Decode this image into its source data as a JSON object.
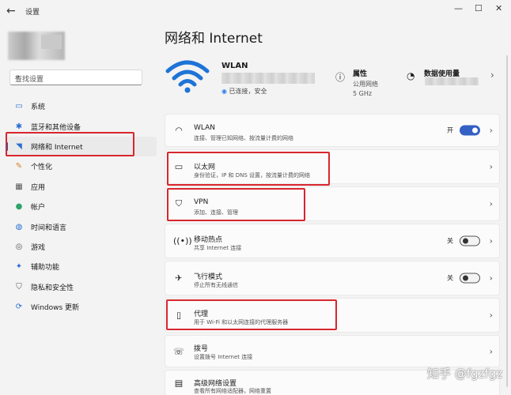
{
  "window": {
    "app_title": "设置",
    "back_icon": "arrow-left-icon",
    "controls": [
      "—",
      "☐",
      "✕"
    ]
  },
  "search": {
    "placeholder": "查找设置"
  },
  "sidebar": {
    "items": [
      {
        "label": "系统",
        "icon": "monitor-icon"
      },
      {
        "label": "蓝牙和其他设备",
        "icon": "bluetooth-icon"
      },
      {
        "label": "网络和 Internet",
        "icon": "wifi-icon",
        "active": true
      },
      {
        "label": "个性化",
        "icon": "brush-icon"
      },
      {
        "label": "应用",
        "icon": "apps-icon"
      },
      {
        "label": "帐户",
        "icon": "person-icon"
      },
      {
        "label": "时间和语言",
        "icon": "globe-icon"
      },
      {
        "label": "游戏",
        "icon": "gamepad-icon"
      },
      {
        "label": "辅助功能",
        "icon": "accessibility-icon"
      },
      {
        "label": "隐私和安全性",
        "icon": "shield-icon"
      },
      {
        "label": "Windows 更新",
        "icon": "update-icon"
      }
    ]
  },
  "header": {
    "title": "网络和 Internet",
    "ssid": "WLAN",
    "status": "已连接，安全",
    "properties": {
      "title": "属性",
      "line1": "公用网络",
      "line2": "5 GHz"
    },
    "data_usage": {
      "title": "数据使用量"
    }
  },
  "rows": [
    {
      "title": "WLAN",
      "desc": "连接、管理已知网络、按流量计费的网络",
      "toggle": "开",
      "on": true
    },
    {
      "title": "以太网",
      "desc": "身份验证，IP 和 DNS 设置，按流量计费的网络"
    },
    {
      "title": "VPN",
      "desc": "添加、连接、管理"
    },
    {
      "title": "移动热点",
      "desc": "共享 Internet 连接",
      "toggle": "关",
      "on": false
    },
    {
      "title": "飞行模式",
      "desc": "停止所有无线通信",
      "toggle": "关",
      "on": false
    },
    {
      "title": "代理",
      "desc": "用于 Wi-Fi 和以太网连接的代理服务器"
    },
    {
      "title": "拨号",
      "desc": "设置拨号 Internet 连接"
    },
    {
      "title": "高级网络设置",
      "desc": "查看所有网络适配器，网络重置"
    }
  ],
  "watermark": "知乎 @fgzfgz",
  "colors": {
    "accent": "#0067c0",
    "toggle_on": "#3560c4",
    "highlight": "#d8262e"
  }
}
